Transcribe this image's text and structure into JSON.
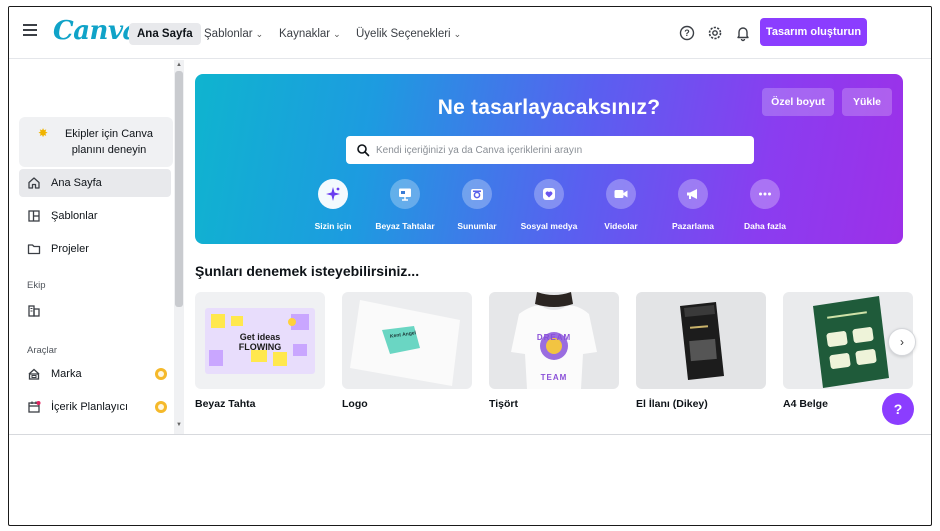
{
  "topbar": {
    "logo": "Canva",
    "nav": [
      {
        "label": "Ana Sayfa",
        "dropdown": false
      },
      {
        "label": "Şablonlar",
        "dropdown": true
      },
      {
        "label": "Kaynaklar",
        "dropdown": true
      },
      {
        "label": "Üyelik Seçenekleri",
        "dropdown": true
      }
    ],
    "icons": [
      "help-icon",
      "settings-icon",
      "notifications-icon"
    ],
    "cta_label": "Tasarım oluşturun",
    "accent_color": "#8b3dff"
  },
  "sidebar": {
    "promo": {
      "text": "Ekipler için Canva planını deneyin",
      "icon": "star-icon"
    },
    "items": [
      {
        "label": "Ana Sayfa",
        "icon": "home-icon",
        "active": true
      },
      {
        "label": "Şablonlar",
        "icon": "templates-icon",
        "active": false
      },
      {
        "label": "Projeler",
        "icon": "folder-icon",
        "active": false
      }
    ],
    "team_heading": "Ekip",
    "team_icon": "team-icon",
    "tools_heading": "Araçlar",
    "tools": [
      {
        "label": "Marka",
        "icon": "brand-icon",
        "premium": true
      },
      {
        "label": "İçerik Planlayıcı",
        "icon": "calendar-icon",
        "premium": true
      }
    ]
  },
  "hero": {
    "title": "Ne tasarlayacaksınız?",
    "custom_size_label": "Özel boyut",
    "upload_label": "Yükle",
    "search_placeholder": "Kendi içeriğinizi ya da Canva içeriklerini arayın",
    "categories": [
      {
        "label": "Sizin için",
        "icon": "sparkle-icon"
      },
      {
        "label": "Beyaz Tahtalar",
        "icon": "whiteboard-icon"
      },
      {
        "label": "Sunumlar",
        "icon": "presentation-icon"
      },
      {
        "label": "Sosyal medya",
        "icon": "heart-icon"
      },
      {
        "label": "Videolar",
        "icon": "video-icon"
      },
      {
        "label": "Pazarlama",
        "icon": "megaphone-icon"
      },
      {
        "label": "Daha fazla",
        "icon": "more-icon"
      }
    ]
  },
  "suggestions": {
    "title": "Şunları denemek isteyebilirsiniz...",
    "cards": [
      {
        "label": "Beyaz Tahta",
        "thumb_text": "Get ideas FLOWING"
      },
      {
        "label": "Logo",
        "thumb_text": "Kent Angel"
      },
      {
        "label": "Tişört",
        "thumb_text": "DREAM TEAM"
      },
      {
        "label": "El İlanı (Dikey)",
        "thumb_text": ""
      },
      {
        "label": "A4 Belge",
        "thumb_text": ""
      }
    ]
  },
  "help_label": "?"
}
